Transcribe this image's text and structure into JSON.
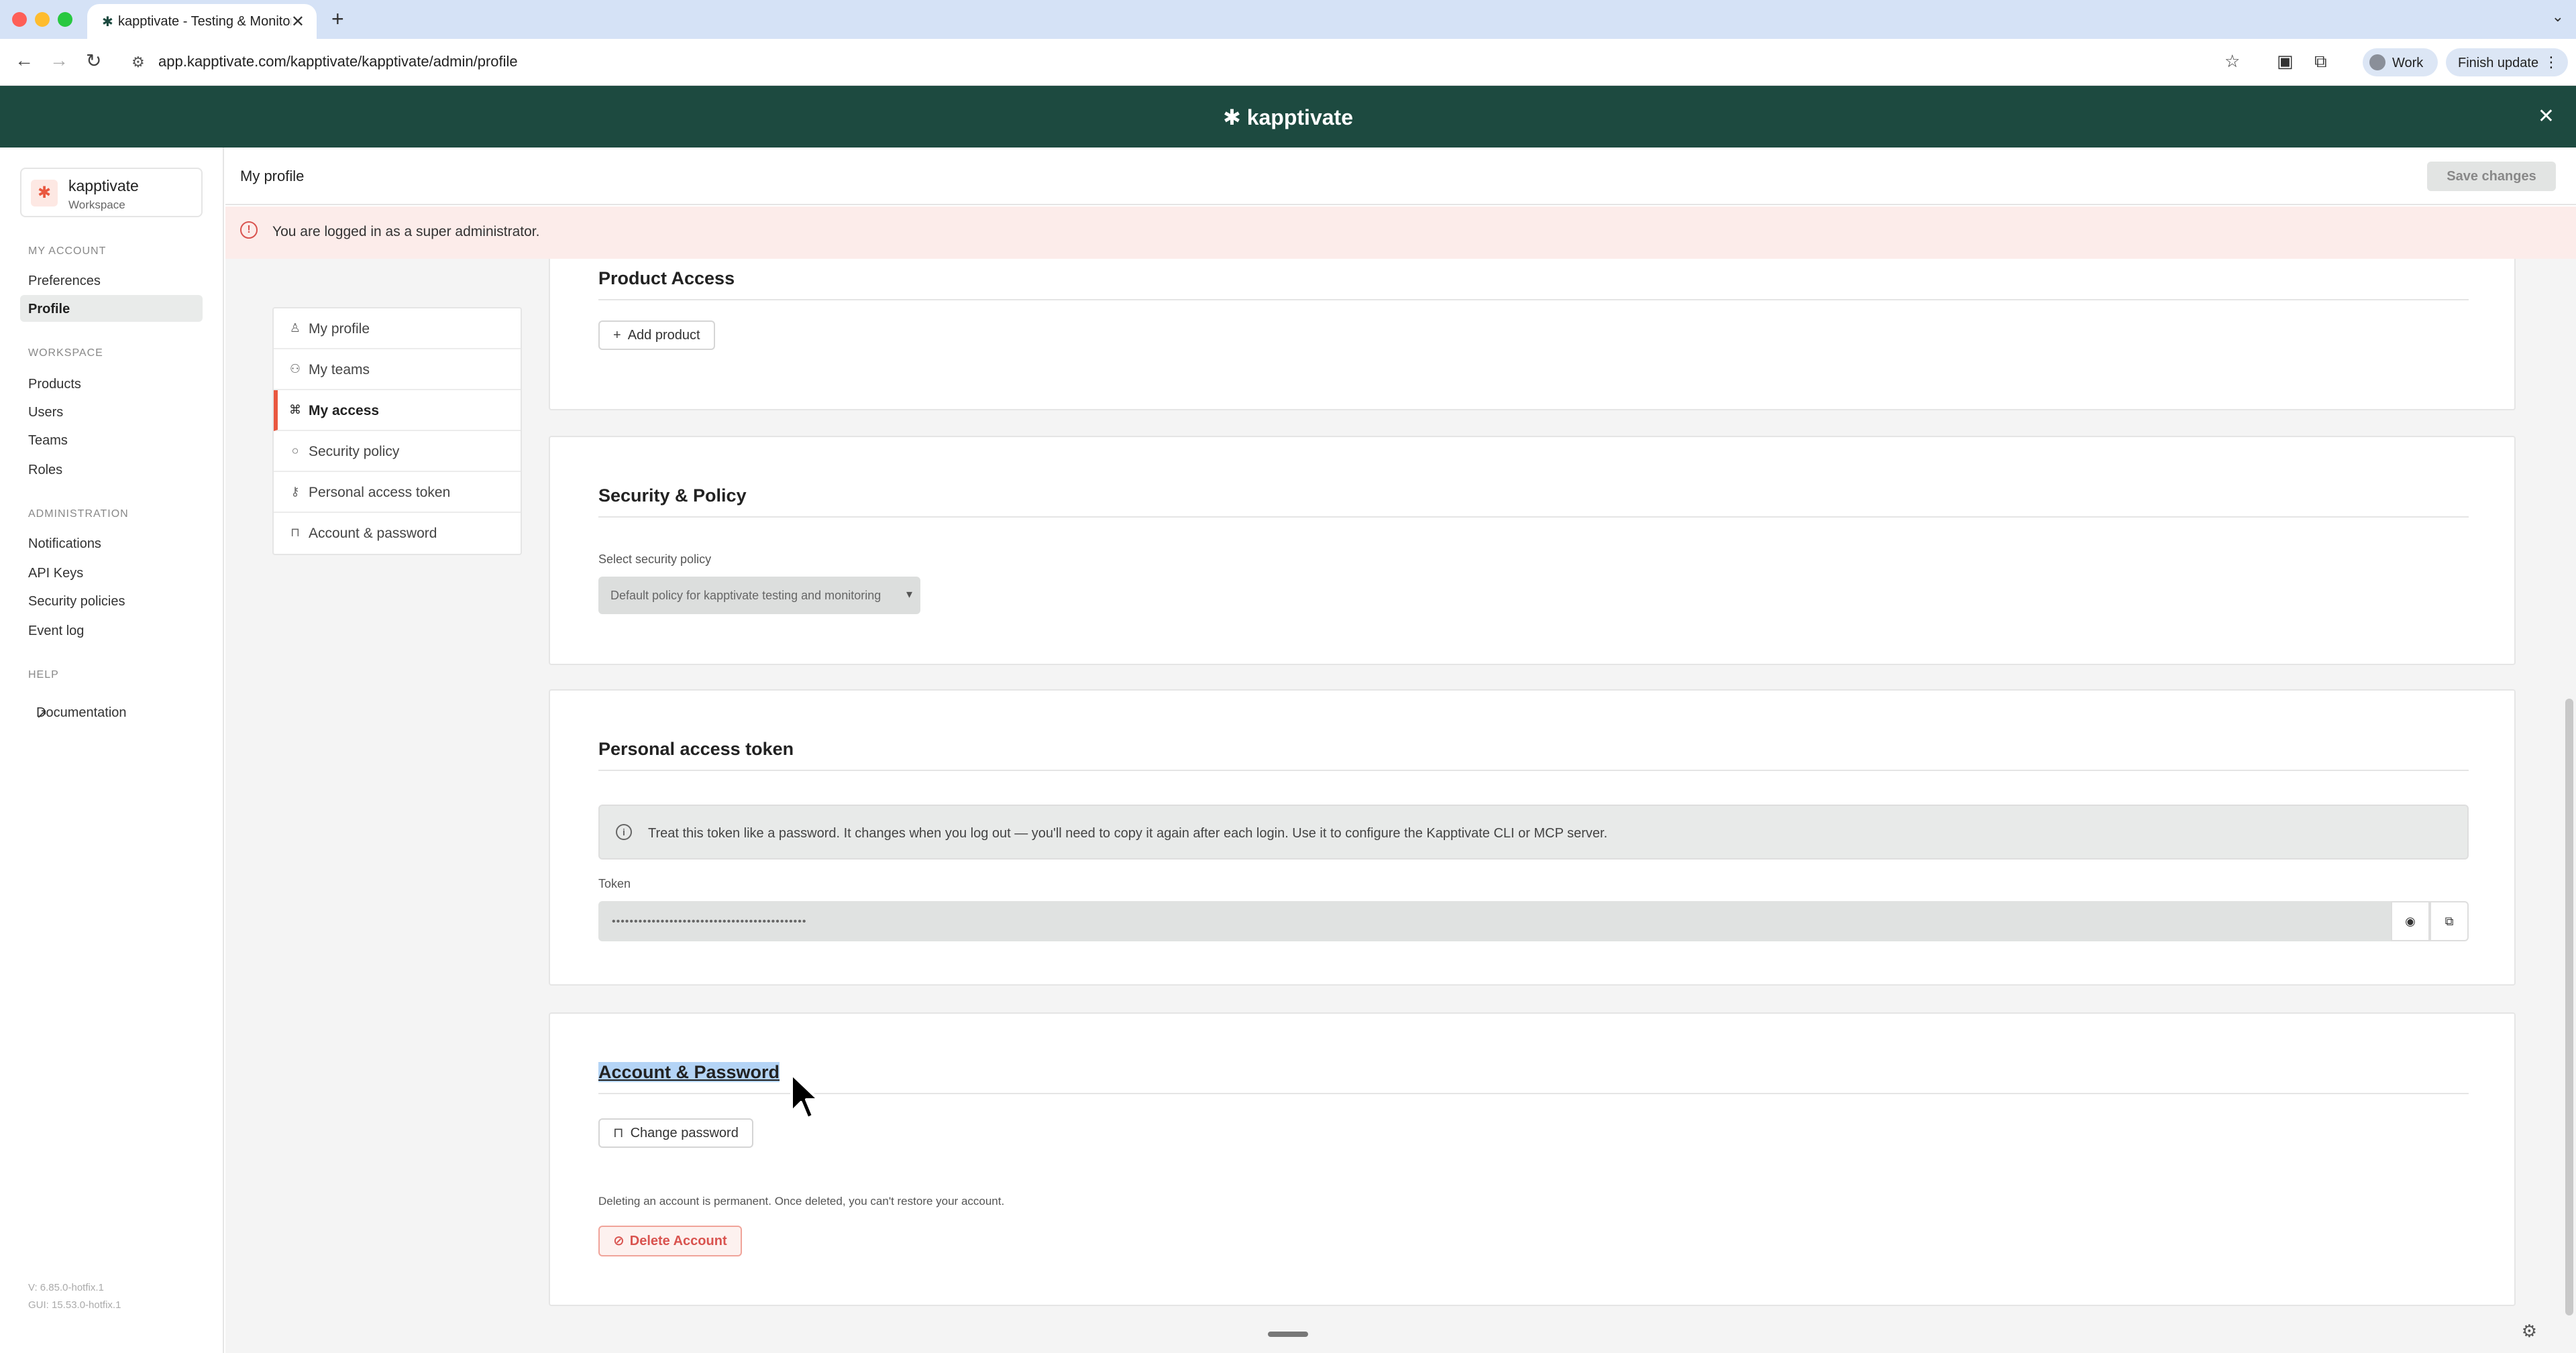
{
  "browser": {
    "tab_title": "kapptivate - Testing & Monitoring",
    "tab_close": "✕",
    "new_tab": "+",
    "url": "app.kapptivate.com/kapptivate/kapptivate/admin/profile",
    "profile_label": "Work",
    "finish_update_label": "Finish update"
  },
  "banner": {
    "brand": "✱ kapptivate",
    "close": "✕"
  },
  "sidebar": {
    "workspace_name": "kapptivate",
    "workspace_sub": "Workspace",
    "sections": {
      "my_account": "MY ACCOUNT",
      "workspace": "WORKSPACE",
      "administration": "ADMINISTRATION",
      "help": "HELP"
    },
    "items": {
      "preferences": "Preferences",
      "profile": "Profile",
      "products": "Products",
      "users": "Users",
      "teams": "Teams",
      "roles": "Roles",
      "notifications": "Notifications",
      "api_keys": "API Keys",
      "security_policies": "Security policies",
      "event_log": "Event log",
      "documentation": "Documentation"
    },
    "version_v": "V: 6.85.0-hotfix.1",
    "version_gui": "GUI: 15.53.0-hotfix.1"
  },
  "header": {
    "page_title": "My profile",
    "save_label": "Save changes"
  },
  "alert": {
    "text": "You are logged in as a super administrator."
  },
  "subnav": {
    "my_profile": "My profile",
    "my_teams": "My teams",
    "my_access": "My access",
    "security_policy": "Security policy",
    "personal_access_token": "Personal access token",
    "account_password": "Account & password"
  },
  "product_access": {
    "title": "Product Access",
    "add_label": "Add product"
  },
  "security_policy": {
    "title": "Security & Policy",
    "select_label": "Select security policy",
    "select_value": "Default policy for kapptivate testing and monitoring"
  },
  "token": {
    "title": "Personal access token",
    "note": "Treat this token like a password. It changes when you log out — you'll need to copy it again after each login. Use it to configure the Kapptivate CLI or MCP server.",
    "field_label": "Token",
    "masked_value": "••••••••••••••••••••••••••••••••••••••••••••"
  },
  "account": {
    "title": "Account & Password",
    "change_password": "Change password",
    "warning": "Deleting an account is permanent. Once deleted, you can't restore your account.",
    "delete_label": "Delete Account"
  }
}
